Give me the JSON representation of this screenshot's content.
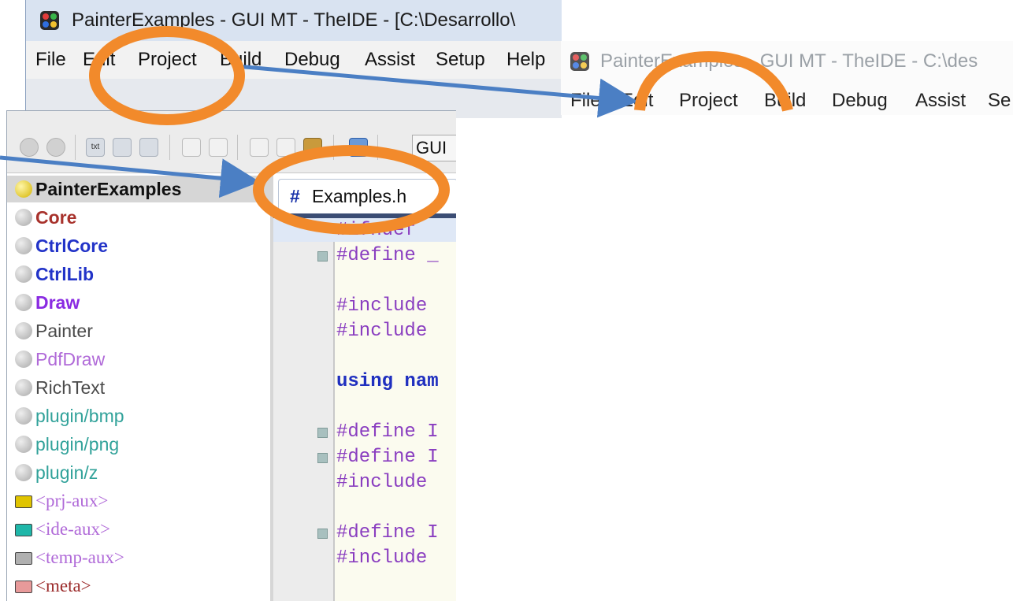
{
  "window_back": {
    "title": "PainterExamples - GUI MT - TheIDE - [C:\\Desarrollo\\",
    "menu": [
      "File",
      "Edit",
      "Project",
      "Build",
      "Debug",
      "Assist",
      "Setup",
      "Help"
    ]
  },
  "window_right": {
    "title": "PainterExamples - GUI MT - TheIDE - C:\\des",
    "menu": [
      "File",
      "Edit",
      "Project",
      "Build",
      "Debug",
      "Assist",
      "Se"
    ]
  },
  "toolbar": {
    "txt_icon_label": "txt",
    "config_combo": "GUI"
  },
  "tree": {
    "main_package": "PainterExamples",
    "packages": [
      {
        "name": "Core",
        "color": "#a8322c"
      },
      {
        "name": "CtrlCore",
        "color": "#2233c8"
      },
      {
        "name": "CtrlLib",
        "color": "#2233c8"
      },
      {
        "name": "Draw",
        "color": "#8a2be2"
      },
      {
        "name": "Painter",
        "color": "#4a4a4a"
      },
      {
        "name": "PdfDraw",
        "color": "#b06ad8"
      },
      {
        "name": "RichText",
        "color": "#4a4a4a"
      },
      {
        "name": "plugin/bmp",
        "color": "#31a29a"
      },
      {
        "name": "plugin/png",
        "color": "#31a29a"
      },
      {
        "name": "plugin/z",
        "color": "#31a29a"
      }
    ],
    "aux": [
      {
        "name": "<prj-aux>",
        "icon_color": "#e0c400",
        "text_color": "#b06ad8"
      },
      {
        "name": "<ide-aux>",
        "icon_color": "#1fb7a9",
        "text_color": "#b06ad8"
      },
      {
        "name": "<temp-aux>",
        "icon_color": "#b0b0b0",
        "text_color": "#b06ad8"
      },
      {
        "name": "<meta>",
        "icon_color": "#e89a9a",
        "text_color": "#9b2a2a"
      }
    ]
  },
  "editor": {
    "tab_hash": "#",
    "tab_name": "Examples.h",
    "lines": [
      {
        "text": "#ifndef",
        "kind": "dir"
      },
      {
        "text": "#define _",
        "kind": "dir"
      },
      {
        "text": "#include",
        "kind": "dir"
      },
      {
        "text": "#include",
        "kind": "dir"
      },
      {
        "text": "using nam",
        "kind": "kw"
      },
      {
        "text": "#define I",
        "kind": "dir"
      },
      {
        "text": "#define I",
        "kind": "dir"
      },
      {
        "text": "#include",
        "kind": "dir"
      },
      {
        "text": "#define I",
        "kind": "dir"
      },
      {
        "text": "#include",
        "kind": "dir"
      }
    ]
  },
  "annotation": {
    "circle_color": "#f28a2b",
    "arrow_color": "#4b7fc4"
  }
}
